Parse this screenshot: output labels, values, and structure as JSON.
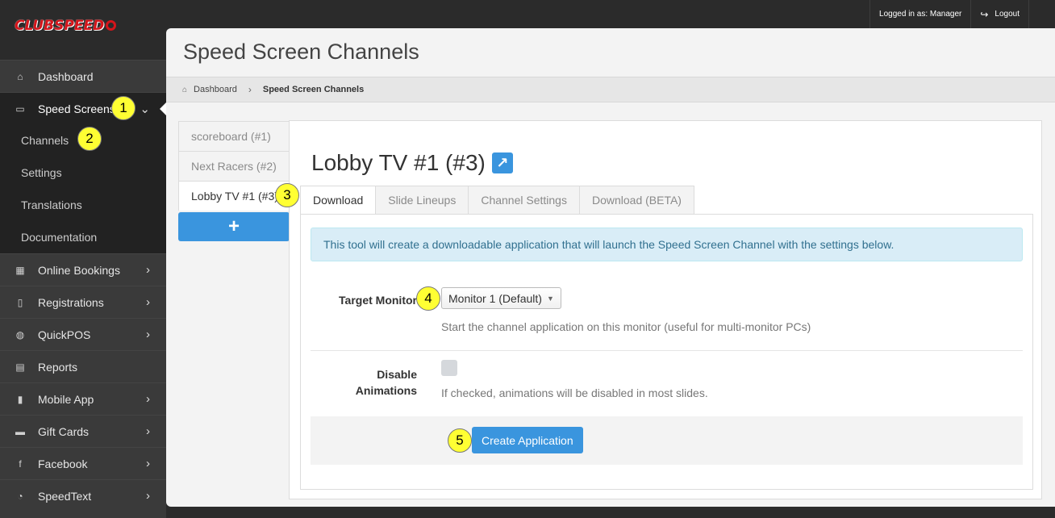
{
  "brand": {
    "logo_text_1": "CLUB",
    "logo_text_2": "SPEED"
  },
  "topbar": {
    "logged_in": "Logged in as: Manager",
    "logout": "Logout"
  },
  "sidebar": {
    "items": [
      {
        "label": "Dashboard",
        "icon": "home-icon"
      },
      {
        "label": "Speed Screens",
        "icon": "monitor-icon"
      },
      {
        "label": "Online Bookings",
        "icon": "calendar-icon"
      },
      {
        "label": "Registrations",
        "icon": "tablet-icon"
      },
      {
        "label": "QuickPOS",
        "icon": "gauge-icon"
      },
      {
        "label": "Reports",
        "icon": "document-icon"
      },
      {
        "label": "Mobile App",
        "icon": "phone-icon"
      },
      {
        "label": "Gift Cards",
        "icon": "card-icon"
      },
      {
        "label": "Facebook",
        "icon": "facebook-icon"
      },
      {
        "label": "SpeedText",
        "icon": "chat-icon"
      }
    ],
    "sub_items": [
      "Channels",
      "Settings",
      "Translations",
      "Documentation"
    ]
  },
  "page": {
    "title": "Speed Screen Channels"
  },
  "breadcrumb": {
    "home": "Dashboard",
    "current": "Speed Screen Channels"
  },
  "channels": [
    "scoreboard (#1)",
    "Next Racers (#2)",
    "Lobby TV #1 (#3)"
  ],
  "add_label": "+",
  "channel": {
    "title": "Lobby TV #1 (#3)"
  },
  "tabs": [
    "Download",
    "Slide Lineups",
    "Channel Settings",
    "Download (BETA)"
  ],
  "download": {
    "info": "This tool will create a downloadable application that will launch the Speed Screen Channel with the settings below.",
    "target_label": "Target Monitor",
    "target_value": "Monitor 1 (Default)",
    "target_help": "Start the channel application on this monitor (useful for multi-monitor PCs)",
    "anim_label_1": "Disable",
    "anim_label_2": "Animations",
    "anim_help": "If checked, animations will be disabled in most slides.",
    "create_button": "Create Application"
  },
  "badges": [
    "1",
    "2",
    "3",
    "4",
    "5"
  ],
  "colors": {
    "accent": "#3a95de",
    "sidebar": "#3a3a3a",
    "badge": "#ffff33",
    "info_bg": "#d9edf7"
  }
}
